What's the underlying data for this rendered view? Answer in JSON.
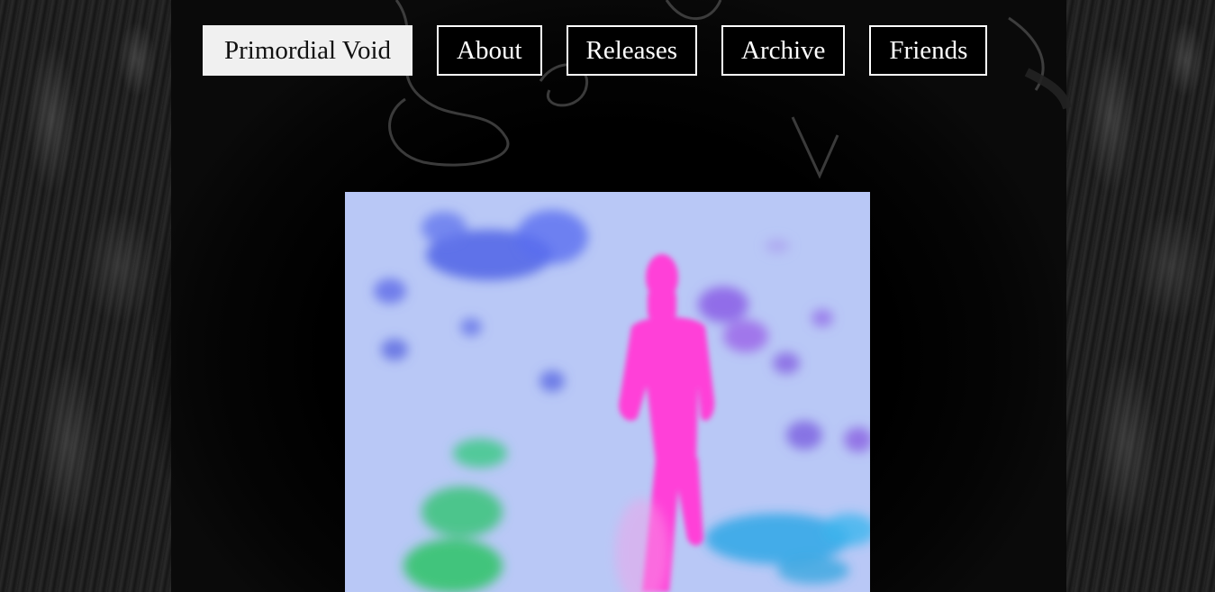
{
  "site": {
    "nav": [
      {
        "label": "Primordial Void",
        "active": true
      },
      {
        "label": "About",
        "active": false
      },
      {
        "label": "Releases",
        "active": false
      },
      {
        "label": "Archive",
        "active": false
      },
      {
        "label": "Friends",
        "active": false
      }
    ]
  },
  "colors": {
    "background": "#0a0a0a",
    "nav_border": "#ffffff",
    "nav_active_bg": "#f0f0f0",
    "figure": "#ff3fd8",
    "sky": "#b9c8f6"
  },
  "media": {
    "icon": "pink-figure-video-icon"
  }
}
